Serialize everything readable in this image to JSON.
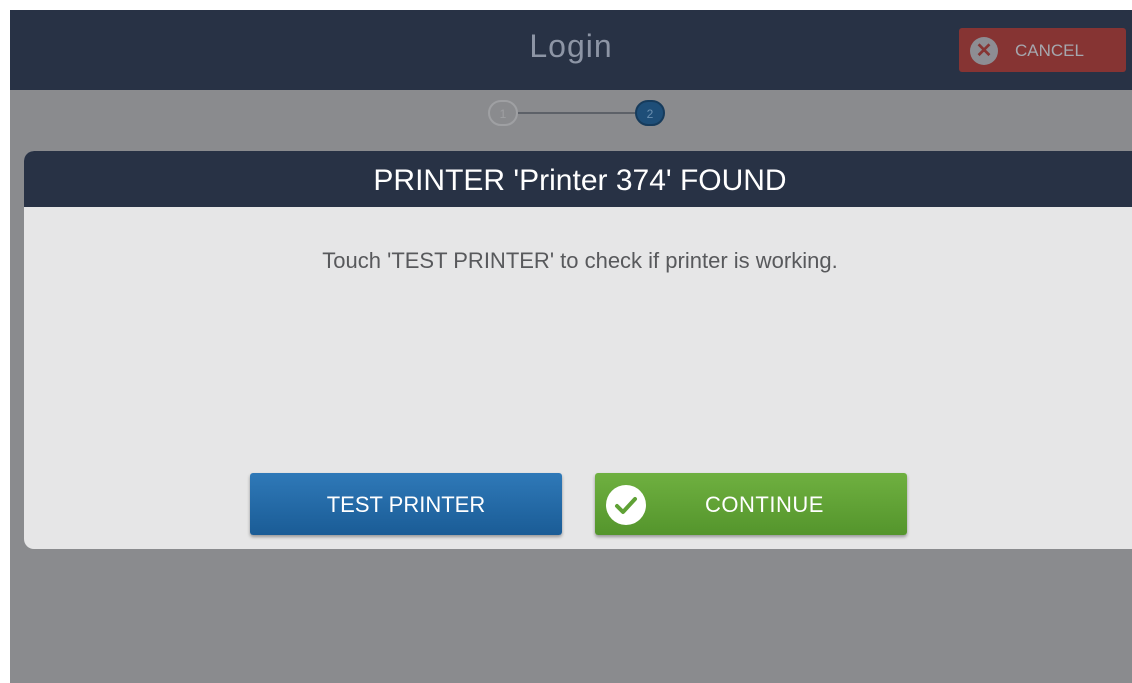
{
  "header": {
    "title": "Login",
    "cancel_label": "CANCEL",
    "cancel_icon": "close-icon"
  },
  "stepper": {
    "steps": [
      "1",
      "2"
    ],
    "current_step": 2
  },
  "dialog": {
    "title": "PRINTER 'Printer 374' FOUND",
    "message": "Touch 'TEST PRINTER' to check if printer is working.",
    "test_button_label": "TEST PRINTER",
    "continue_button_label": "CONTINUE",
    "continue_icon": "check-icon"
  },
  "colors": {
    "header_bg": "#283245",
    "cancel_bg": "#863433",
    "test_button": "#1f6aa8",
    "continue_button": "#5fa135",
    "overlay_bg": "#8a8b8e"
  }
}
